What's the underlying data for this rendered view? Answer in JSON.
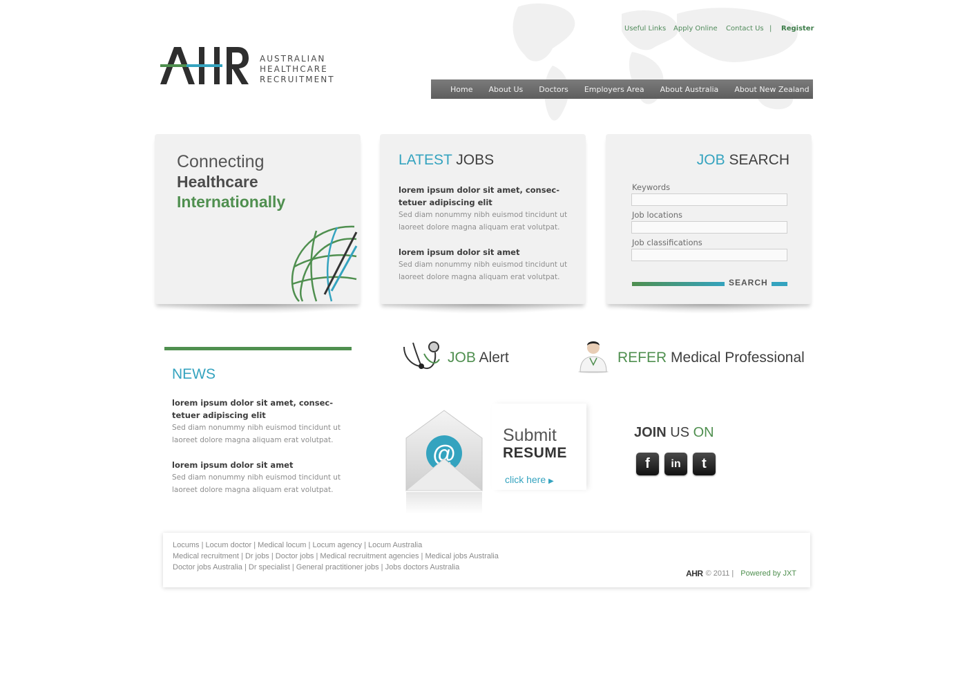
{
  "top_links": {
    "useful_links": "Useful Links",
    "apply_online": "Apply Online",
    "contact_us": "Contact Us",
    "separator": "|",
    "register": "Register"
  },
  "logo": {
    "mark": "AHR",
    "line1": "AUSTRALIAN",
    "line2": "HEALTHCARE",
    "line3": "RECRUITMENT"
  },
  "nav": {
    "items": [
      "Home",
      "About Us",
      "Doctors",
      "Employers Area",
      "About Australia",
      "About New Zealand"
    ]
  },
  "hero": {
    "line1": "Connecting",
    "line2": "Healthcare",
    "line3": "Internationally"
  },
  "latest_jobs": {
    "title_accent": "LATEST",
    "title_dark": "JOBS",
    "items": [
      {
        "title": "lorem ipsum dolor sit amet, consec-tetuer adipiscing elit",
        "body": "Sed diam nonummy nibh euismod tincidunt ut laoreet dolore magna aliquam erat volutpat."
      },
      {
        "title": "lorem ipsum dolor sit amet",
        "body": "Sed diam nonummy nibh euismod tincidunt ut laoreet dolore magna aliquam erat volutpat."
      }
    ]
  },
  "job_search": {
    "title_accent": "JOB",
    "title_dark": "SEARCH",
    "keywords_label": "Keywords",
    "locations_label": "Job locations",
    "classifications_label": "Job classifications",
    "keywords_value": "",
    "locations_value": "",
    "classifications_value": "",
    "search_button": "SEARCH"
  },
  "news": {
    "title": "NEWS",
    "items": [
      {
        "title": "lorem ipsum dolor sit amet, consec-tetuer adipiscing elit",
        "body": "Sed diam nonummy nibh euismod tincidunt ut laoreet dolore magna aliquam erat volutpat."
      },
      {
        "title": "lorem ipsum dolor sit amet",
        "body": "Sed diam nonummy nibh euismod tincidunt ut laoreet dolore magna aliquam erat volutpat."
      }
    ]
  },
  "job_alert": {
    "accent": "JOB",
    "dark": "Alert"
  },
  "refer": {
    "accent": "REFER",
    "dark": "Medical Professional"
  },
  "resume": {
    "submit": "Submit",
    "resume": "RESUME",
    "click": "click here"
  },
  "join": {
    "join": "JOIN",
    "us": "US",
    "on": "ON"
  },
  "social": {
    "facebook": "f",
    "linkedin": "in",
    "twitter": "t"
  },
  "footer": {
    "line1": [
      "Locums",
      "Locum doctor",
      "Medical locum",
      "Locum agency",
      "Locum Australia"
    ],
    "line2": [
      "Medical recruitment",
      "Dr jobs",
      "Doctor jobs",
      "Medical recruitment agencies",
      "Medical jobs Australia"
    ],
    "line3": [
      "Doctor jobs Australia",
      "Dr specialist",
      "General practitioner jobs",
      "Jobs doctors Australia"
    ],
    "logo": "AHR",
    "copyright": "© 2011  |",
    "powered": "Powered by JXT"
  },
  "colors": {
    "accent_blue": "#34a3bf",
    "accent_green": "#4f8f4f",
    "nav_gray": "#6e6e6e"
  }
}
